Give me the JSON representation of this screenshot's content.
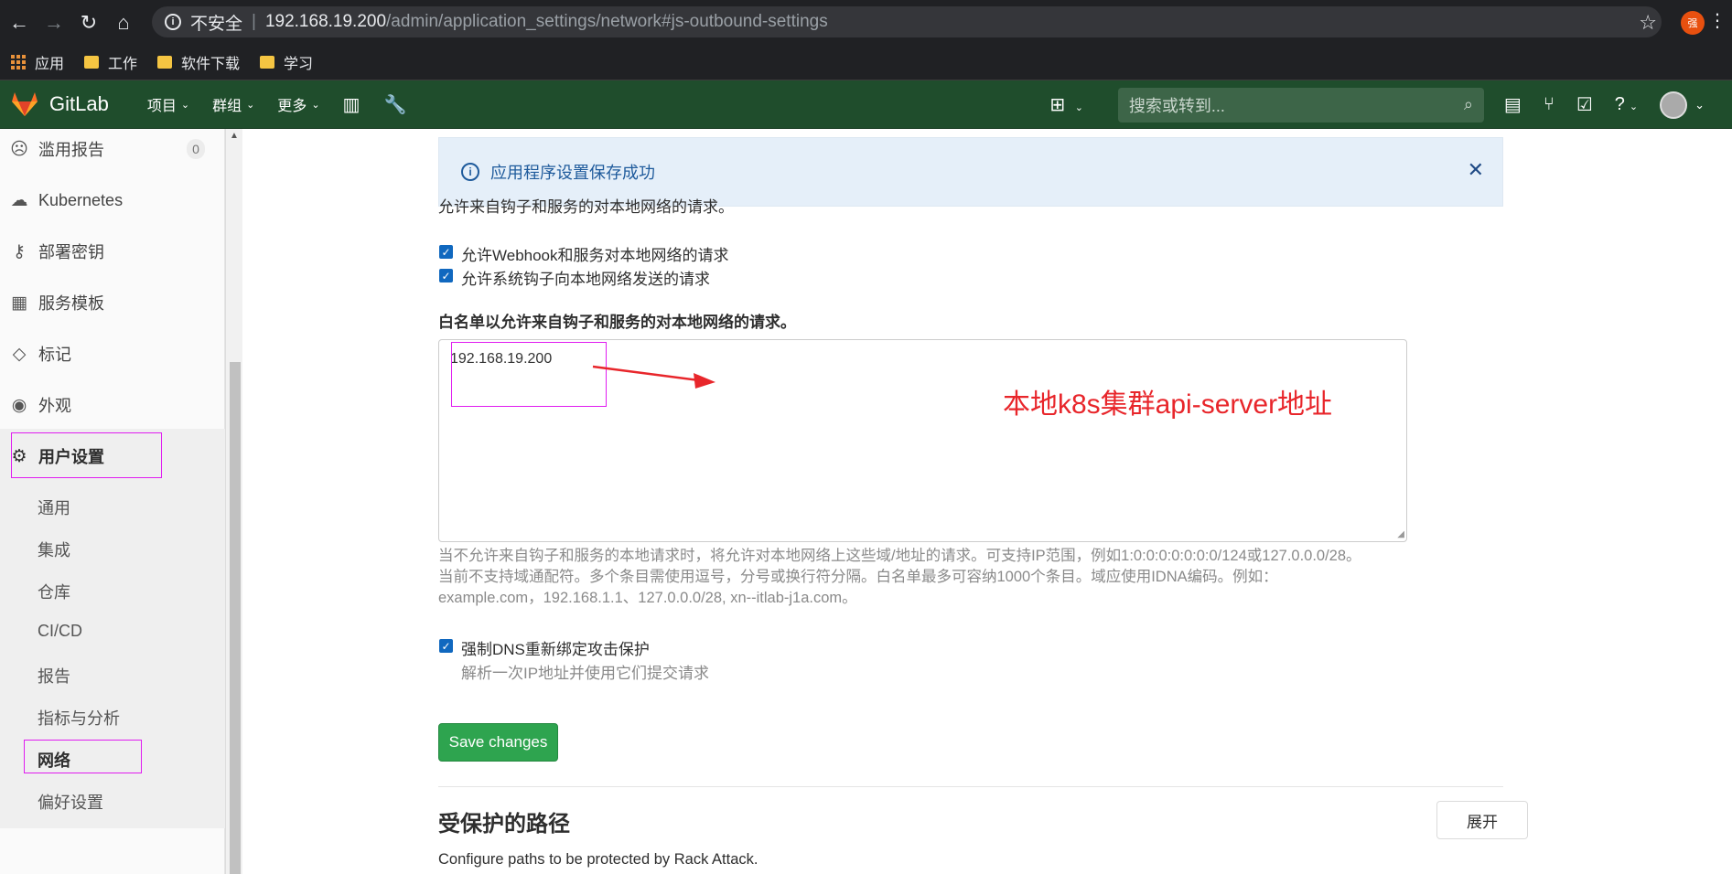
{
  "browser": {
    "security_label": "不安全",
    "url_host": "192.168.19.200",
    "url_path": "/admin/application_settings/network#js-outbound-settings",
    "profile_initial": "强"
  },
  "bookmarks": [
    {
      "label": "应用"
    },
    {
      "label": "工作"
    },
    {
      "label": "软件下载"
    },
    {
      "label": "学习"
    }
  ],
  "gitlab_nav": {
    "brand": "GitLab",
    "menu": [
      "项目",
      "群组",
      "更多"
    ],
    "search_placeholder": "搜索或转到..."
  },
  "sidebar": {
    "items": [
      {
        "label": "滥用报告",
        "badge": "0",
        "icon": "frown-icon"
      },
      {
        "label": "Kubernetes",
        "icon": "cloud-icon"
      },
      {
        "label": "部署密钥",
        "icon": "key-icon"
      },
      {
        "label": "服务模板",
        "icon": "template-icon"
      },
      {
        "label": "标记",
        "icon": "label-icon"
      },
      {
        "label": "外观",
        "icon": "palette-icon"
      },
      {
        "label": "用户设置",
        "icon": "gear-icon"
      }
    ],
    "subitems": [
      "通用",
      "集成",
      "仓库",
      "CI/CD",
      "报告",
      "指标与分析",
      "网络",
      "偏好设置"
    ]
  },
  "flash": {
    "message": "应用程序设置保存成功"
  },
  "form": {
    "intro": "允许来自钩子和服务的对本地网络的请求。",
    "checkbox1": "允许Webhook和服务对本地网络的请求",
    "checkbox2": "允许系统钩子向本地网络发送的请求",
    "whitelist_label": "白名单以允许来自钩子和服务的对本地网络的请求。",
    "whitelist_value": "192.168.19.200",
    "help_line1": "当不允许来自钩子和服务的本地请求时，将允许对本地网络上这些域/地址的请求。可支持IP范围，例如1:0:0:0:0:0:0:0/124或127.0.0.0/28。",
    "help_line2": "当前不支持域通配符。多个条目需使用逗号，分号或换行符分隔。白名单最多可容纳1000个条目。域应使用IDNA编码。例如：",
    "help_line3": "example.com，192.168.1.1、127.0.0.0/28, xn--itlab-j1a.com。",
    "dns_checkbox": "强制DNS重新绑定攻击保护",
    "dns_help": "解析一次IP地址并使用它们提交请求",
    "save_label": "Save changes"
  },
  "protected_paths": {
    "title": "受保护的路径",
    "description": "Configure paths to be protected by Rack Attack.",
    "expand_label": "展开"
  },
  "annotation": {
    "text": "本地k8s集群api-server地址",
    "color": "#e8262b"
  }
}
